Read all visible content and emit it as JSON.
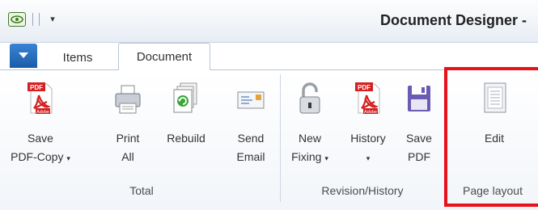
{
  "window": {
    "title": "Document Designer -"
  },
  "quick_access": {
    "dropdown_glyph": "▾"
  },
  "tabs": [
    {
      "label": "Items",
      "active": false
    },
    {
      "label": "Document",
      "active": true
    }
  ],
  "ribbon": {
    "groups": [
      {
        "label": "Total",
        "buttons": [
          {
            "line1": "Save",
            "line2": "PDF-Copy",
            "has_caret": true,
            "icon": "pdf-icon"
          },
          {
            "line1": "Print",
            "line2": "All",
            "has_caret": false,
            "icon": "printer-icon"
          },
          {
            "line1": "Rebuild",
            "line2": "",
            "has_caret": false,
            "icon": "rebuild-icon"
          },
          {
            "line1": "Send",
            "line2": "Email",
            "has_caret": false,
            "icon": "email-icon"
          }
        ]
      },
      {
        "label": "Revision/History",
        "buttons": [
          {
            "line1": "New",
            "line2": "Fixing",
            "has_caret": true,
            "icon": "padlock-icon"
          },
          {
            "line1": "History",
            "line2": "",
            "has_caret": true,
            "icon": "pdf-icon"
          },
          {
            "line1": "Save",
            "line2": "PDF",
            "has_caret": false,
            "icon": "save-disk-icon"
          }
        ]
      },
      {
        "label": "Page layout",
        "buttons": [
          {
            "line1": "Edit",
            "line2": "",
            "has_caret": false,
            "icon": "page-icon"
          }
        ]
      }
    ],
    "caret_glyph": "▾",
    "pdf_badge": "PDF",
    "adobe_badge": "Adobe"
  },
  "colors": {
    "highlight_border": "#e8101a",
    "app_button": "#1c5ca8",
    "pdf_red": "#d42020",
    "save_disk": "#6b5bb3"
  }
}
